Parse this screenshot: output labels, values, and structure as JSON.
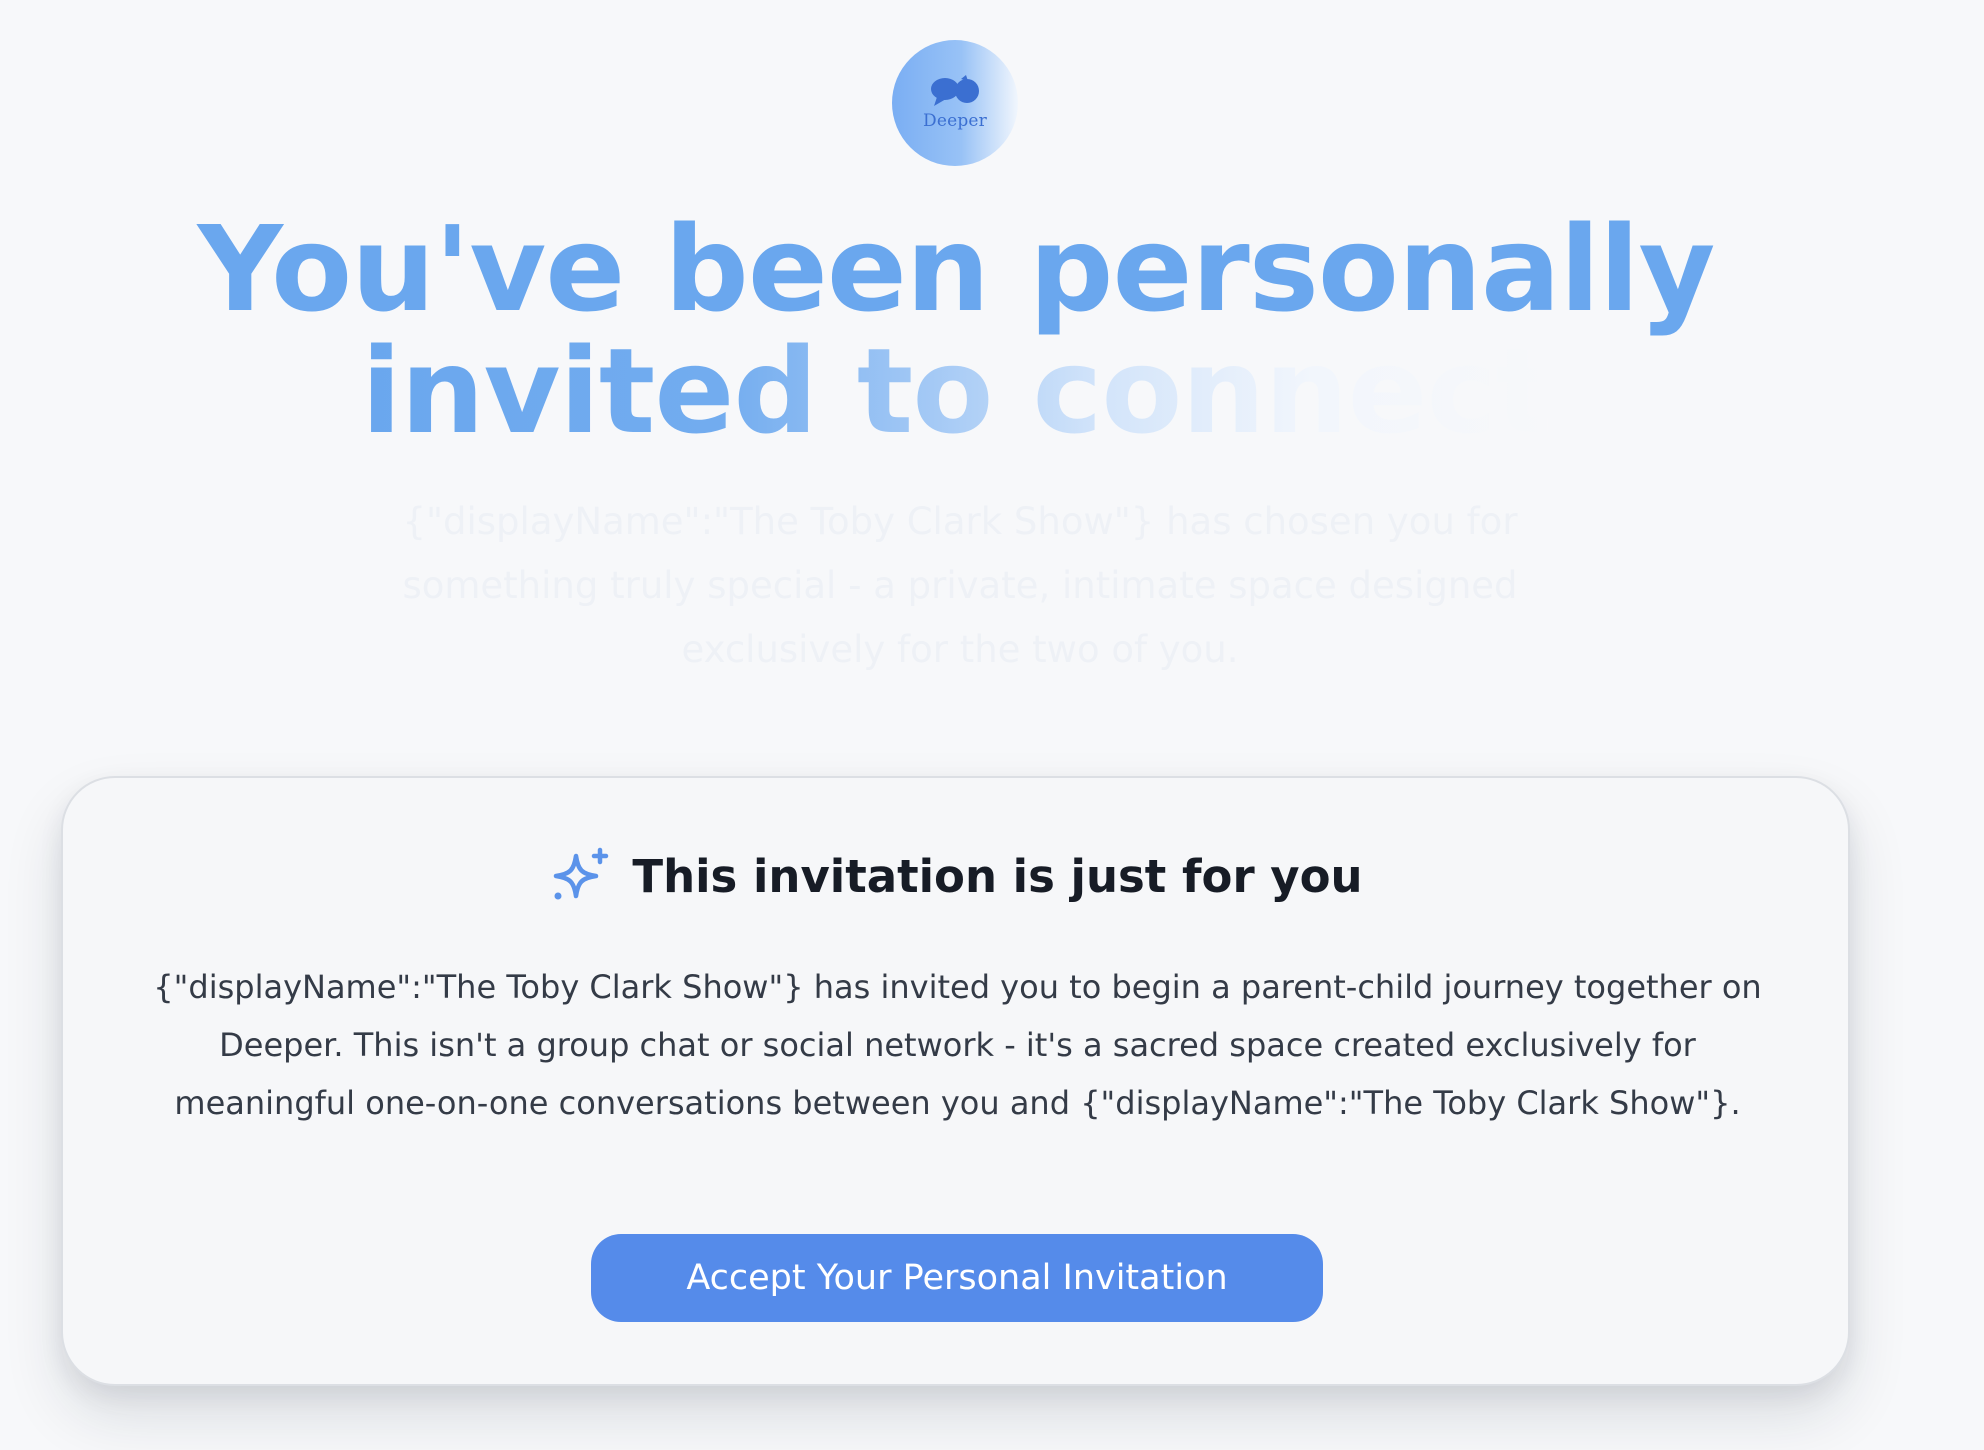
{
  "logo": {
    "text": "Deeper",
    "icon": "speech-bubbles-icon"
  },
  "hero": {
    "title_line1": "You've been personally",
    "title_line2": "invited to connect",
    "subtitle": "{\"displayName\":\"The Toby Clark Show\"} has chosen you for something truly special - a private, intimate space designed exclusively for the two of you."
  },
  "card": {
    "icon": "sparkle-icon",
    "title": "This invitation is just for you",
    "body": "{\"displayName\":\"The Toby Clark Show\"} has invited you to begin a parent-child journey together on Deeper. This isn't a group chat or social network - it's a sacred space created exclusively for meaningful one-on-one conversations between you and {\"displayName\":\"The Toby Clark Show\"}.",
    "button_label": "Accept Your Personal Invitation"
  },
  "colors": {
    "accent": "#558bea",
    "hero_blue": "#6aa7ee",
    "background": "#f7f8fa",
    "text_dark": "#171c26"
  }
}
